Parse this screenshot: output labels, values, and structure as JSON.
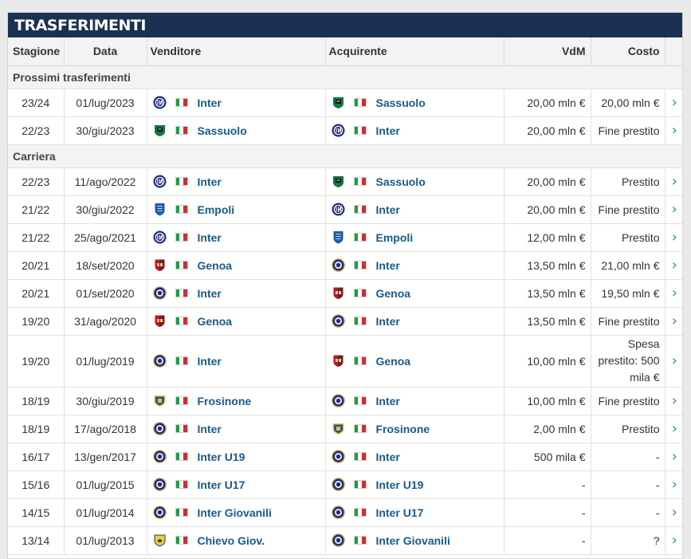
{
  "title": "TRASFERIMENTI",
  "columns": {
    "season": "Stagione",
    "date": "Data",
    "seller": "Venditore",
    "buyer": "Acquirente",
    "value": "VdM",
    "cost": "Costo"
  },
  "sections": [
    {
      "label": "Prossimi trasferimenti",
      "rows": [
        {
          "season": "23/24",
          "date": "01/lug/2023",
          "seller": "Inter",
          "seller_crest": "inter-icon",
          "buyer": "Sassuolo",
          "buyer_crest": "sassuolo-icon",
          "value": "20,00 mln €",
          "cost": "20,00 mln €"
        },
        {
          "season": "22/23",
          "date": "30/giu/2023",
          "seller": "Sassuolo",
          "seller_crest": "sassuolo-icon",
          "buyer": "Inter",
          "buyer_crest": "inter-icon",
          "value": "20,00 mln €",
          "cost": "Fine prestito"
        }
      ]
    },
    {
      "label": "Carriera",
      "rows": [
        {
          "season": "22/23",
          "date": "11/ago/2022",
          "seller": "Inter",
          "seller_crest": "inter-icon",
          "buyer": "Sassuolo",
          "buyer_crest": "sassuolo-icon",
          "value": "20,00 mln €",
          "cost": "Prestito"
        },
        {
          "season": "21/22",
          "date": "30/giu/2022",
          "seller": "Empoli",
          "seller_crest": "empoli-icon",
          "buyer": "Inter",
          "buyer_crest": "inter-icon",
          "value": "20,00 mln €",
          "cost": "Fine prestito"
        },
        {
          "season": "21/22",
          "date": "25/ago/2021",
          "seller": "Inter",
          "seller_crest": "inter-icon",
          "buyer": "Empoli",
          "buyer_crest": "empoli-icon",
          "value": "12,00 mln €",
          "cost": "Prestito"
        },
        {
          "season": "20/21",
          "date": "18/set/2020",
          "seller": "Genoa",
          "seller_crest": "genoa-icon",
          "buyer": "Inter",
          "buyer_crest": "inter-old-icon",
          "value": "13,50 mln €",
          "cost": "21,00 mln €"
        },
        {
          "season": "20/21",
          "date": "01/set/2020",
          "seller": "Inter",
          "seller_crest": "inter-old-icon",
          "buyer": "Genoa",
          "buyer_crest": "genoa-icon",
          "value": "13,50 mln €",
          "cost": "19,50 mln €"
        },
        {
          "season": "19/20",
          "date": "31/ago/2020",
          "seller": "Genoa",
          "seller_crest": "genoa-icon",
          "buyer": "Inter",
          "buyer_crest": "inter-old-icon",
          "value": "13,50 mln €",
          "cost": "Fine prestito"
        },
        {
          "season": "19/20",
          "date": "01/lug/2019",
          "seller": "Inter",
          "seller_crest": "inter-old-icon",
          "buyer": "Genoa",
          "buyer_crest": "genoa-icon",
          "value": "10,00 mln €",
          "cost": "Spesa prestito: 500 mila €",
          "tall": true
        },
        {
          "season": "18/19",
          "date": "30/giu/2019",
          "seller": "Frosinone",
          "seller_crest": "frosinone-icon",
          "buyer": "Inter",
          "buyer_crest": "inter-old-icon",
          "value": "10,00 mln €",
          "cost": "Fine prestito"
        },
        {
          "season": "18/19",
          "date": "17/ago/2018",
          "seller": "Inter",
          "seller_crest": "inter-old-icon",
          "buyer": "Frosinone",
          "buyer_crest": "frosinone-icon",
          "value": "2,00 mln €",
          "cost": "Prestito"
        },
        {
          "season": "16/17",
          "date": "13/gen/2017",
          "seller": "Inter U19",
          "seller_crest": "inter-old-icon",
          "buyer": "Inter",
          "buyer_crest": "inter-old-icon",
          "value": "500 mila €",
          "cost": "-"
        },
        {
          "season": "15/16",
          "date": "01/lug/2015",
          "seller": "Inter U17",
          "seller_crest": "inter-old-icon",
          "buyer": "Inter U19",
          "buyer_crest": "inter-old-icon",
          "value": "-",
          "cost": "-"
        },
        {
          "season": "14/15",
          "date": "01/lug/2014",
          "seller": "Inter Giovanili",
          "seller_crest": "inter-old-icon",
          "buyer": "Inter U17",
          "buyer_crest": "inter-old-icon",
          "value": "-",
          "cost": "-"
        },
        {
          "season": "13/14",
          "date": "01/lug/2013",
          "seller": "Chievo Giov.",
          "seller_crest": "chievo-icon",
          "buyer": "Inter Giovanili",
          "buyer_crest": "inter-old-icon",
          "value": "-",
          "cost": "?"
        }
      ]
    }
  ],
  "flag_icon": "italy-flag-icon",
  "arrow_icon": "chevron-right-icon",
  "colors": {
    "header_bg": "#1a3151",
    "club_link": "#1a5a8a",
    "arrow": "#2c87c7"
  }
}
